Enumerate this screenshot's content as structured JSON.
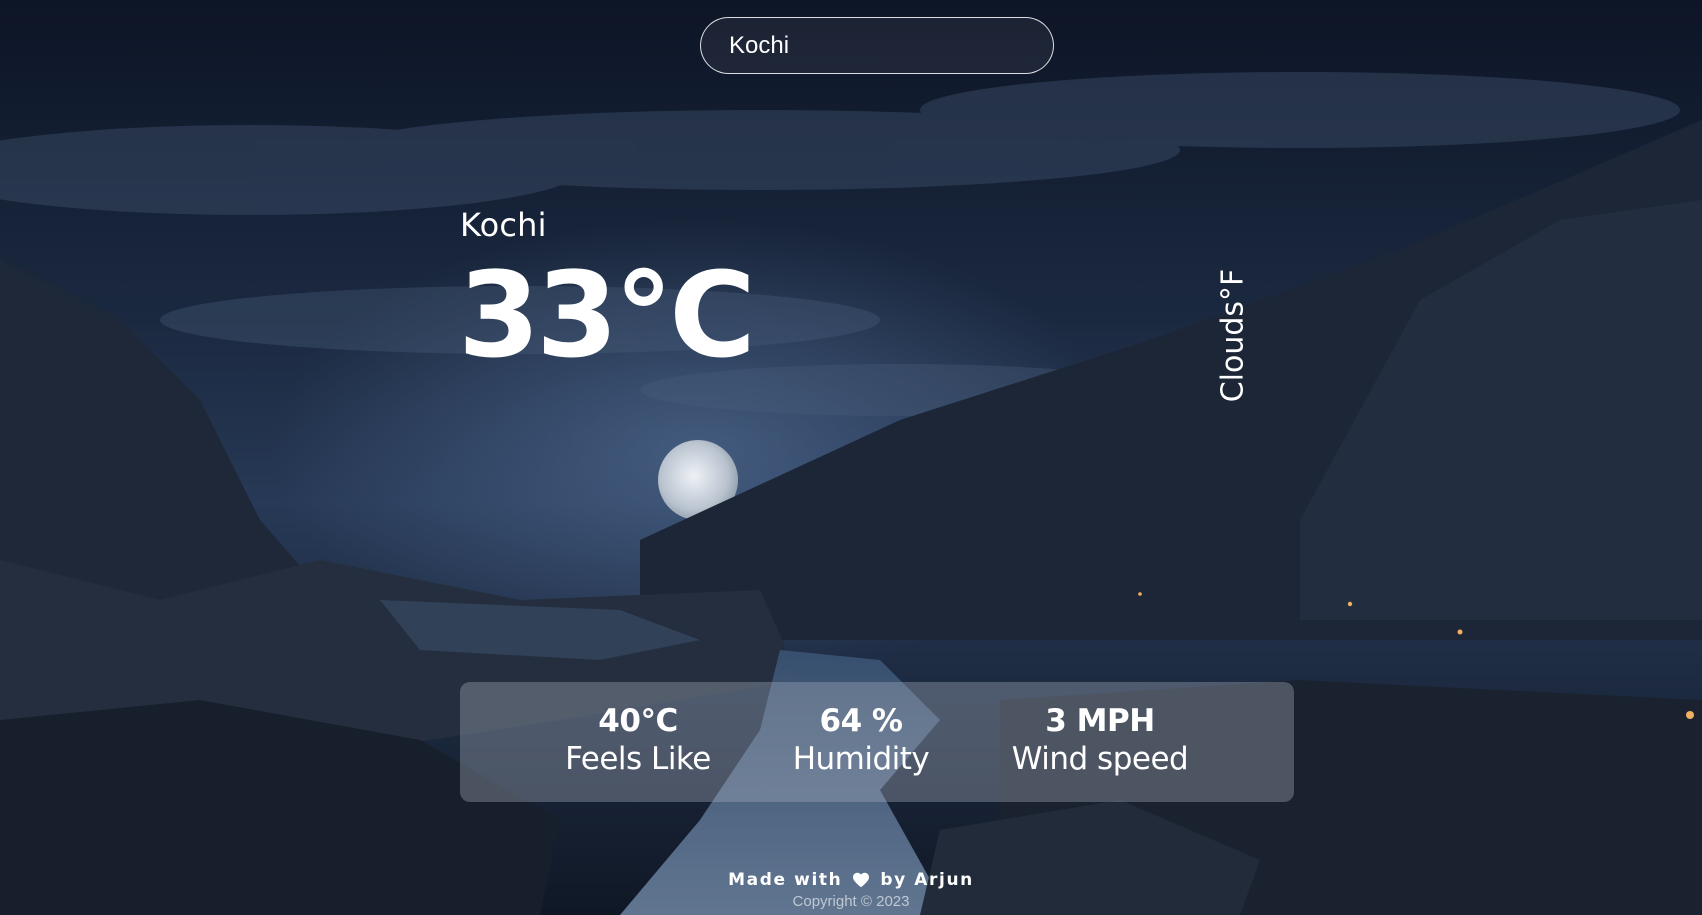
{
  "search": {
    "value": "Kochi"
  },
  "weather": {
    "city": "Kochi",
    "temperature": "33°C",
    "condition": "Clouds",
    "unit_toggle": "°F"
  },
  "stats": [
    {
      "value": "40°C",
      "label": "Feels Like"
    },
    {
      "value": "64 %",
      "label": "Humidity"
    },
    {
      "value": "3 MPH",
      "label": "Wind speed"
    }
  ],
  "footer": {
    "made_with_prefix": "Made with",
    "heart_icon": "heart-icon",
    "made_with_suffix": "by Arjun",
    "copyright": "Copyright © 2023"
  }
}
